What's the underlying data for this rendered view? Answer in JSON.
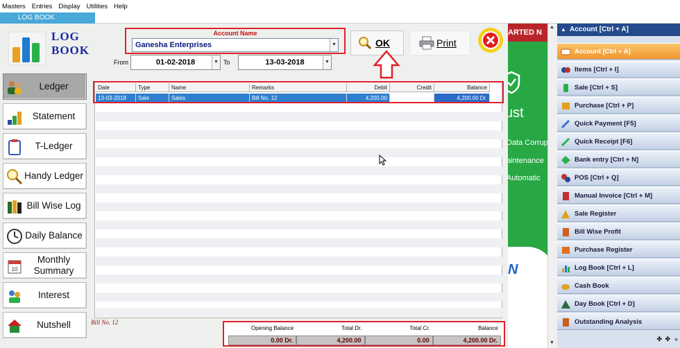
{
  "menubar": [
    "Masters",
    "Entries",
    "Display",
    "Utilities",
    "Help"
  ],
  "tab_title": "LOG BOOK",
  "logo_text_line1": "LOG",
  "logo_text_line2": "BOOK",
  "account": {
    "label": "Account Name",
    "value": "Ganesha Enterprises"
  },
  "dates": {
    "from_label": "From",
    "from": "01-02-2018",
    "to_label": "To",
    "to": "13-03-2018"
  },
  "buttons": {
    "ok": "OK",
    "print": "Print"
  },
  "sidebar": [
    {
      "label": "Ledger",
      "icon": "users-icon",
      "active": true
    },
    {
      "label": "Statement",
      "icon": "stairs-chart-icon"
    },
    {
      "label": "T-Ledger",
      "icon": "clipboard-icon"
    },
    {
      "label": "Handy Ledger",
      "icon": "magnifier-icon"
    },
    {
      "label": "Bill Wise Log",
      "icon": "books-icon"
    },
    {
      "label": "Daily Balance",
      "icon": "clock-icon"
    },
    {
      "label": "Monthly Summary",
      "icon": "calendar-icon"
    },
    {
      "label": "Interest",
      "icon": "people-money-icon"
    },
    {
      "label": "Nutshell",
      "icon": "house-icon"
    }
  ],
  "table": {
    "columns": [
      "Date",
      "Type",
      "Name",
      "Remarks",
      "Debit",
      "Credit",
      "Balance"
    ],
    "rows": [
      {
        "date": "13-03-2018",
        "type": "Sale",
        "name": "Sales",
        "remarks": "Bill No. 12",
        "debit": "4,200.00",
        "credit": "",
        "balance": "4,200.00 Dr."
      }
    ]
  },
  "bill_note": "Bill No. 12",
  "totals": {
    "headers": [
      "Opening Balance",
      "Total Dr.",
      "Total Cr.",
      "Balance"
    ],
    "values": [
      "0.00 Dr.",
      "4,200.00",
      "0.00",
      "4,200.00 Dr."
    ]
  },
  "middle_panel": {
    "banner": "ARTED N",
    "big": "ust",
    "lines": [
      "Data Corrup",
      "aintenance",
      "Automatic"
    ],
    "bottom": "N"
  },
  "right_panel": {
    "title": "Account [Ctrl + A]",
    "items": [
      {
        "label": "Account [Ctrl + A]",
        "active": true,
        "icon": "account-icon"
      },
      {
        "label": "Items [Ctrl + I]",
        "icon": "items-icon"
      },
      {
        "label": "Sale [Ctrl + S]",
        "icon": "sale-icon"
      },
      {
        "label": "Purchase [Ctrl + P]",
        "icon": "purchase-icon"
      },
      {
        "label": "Quick Payment [F5]",
        "icon": "quick-payment-icon"
      },
      {
        "label": "Quick Receipt [F6]",
        "icon": "quick-receipt-icon"
      },
      {
        "label": "Bank entry [Ctrl + N]",
        "icon": "bank-entry-icon"
      },
      {
        "label": "POS [Ctrl + Q]",
        "icon": "pos-icon"
      },
      {
        "label": "Manual Invoice [Ctrl + M]",
        "icon": "manual-invoice-icon"
      },
      {
        "label": "Sale Register",
        "icon": "sale-register-icon"
      },
      {
        "label": "Bill Wise Profit",
        "icon": "bill-wise-profit-icon"
      },
      {
        "label": "Purchase Register",
        "icon": "purchase-register-icon"
      },
      {
        "label": "Log Book [Ctrl + L]",
        "icon": "log-book-icon"
      },
      {
        "label": "Cash Book",
        "icon": "cash-book-icon"
      },
      {
        "label": "Day Book [Ctrl + D]",
        "icon": "day-book-icon"
      },
      {
        "label": "Outstanding Analysis",
        "icon": "outstanding-analysis-icon"
      }
    ]
  },
  "colors": {
    "accent_red": "#e0202a",
    "selection_blue": "#2f7fcf",
    "brand_navy": "#1a2aa0",
    "panel_orange": "#f0962c"
  }
}
